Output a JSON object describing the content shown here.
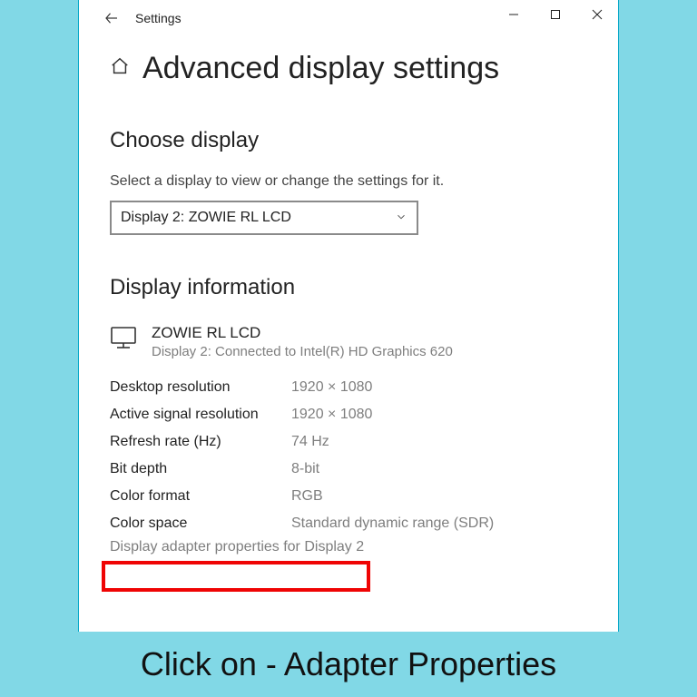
{
  "titlebar": {
    "title": "Settings"
  },
  "page": {
    "heading": "Advanced display settings"
  },
  "choose": {
    "title": "Choose display",
    "subtitle": "Select a display to view or change the settings for it.",
    "selected": "Display 2: ZOWIE RL LCD"
  },
  "info": {
    "title": "Display information",
    "display_name": "ZOWIE RL LCD",
    "display_conn": "Display 2: Connected to Intel(R) HD Graphics 620",
    "rows": [
      {
        "label": "Desktop resolution",
        "value": "1920 × 1080"
      },
      {
        "label": "Active signal resolution",
        "value": "1920 × 1080"
      },
      {
        "label": "Refresh rate (Hz)",
        "value": "74 Hz"
      },
      {
        "label": "Bit depth",
        "value": "8-bit"
      },
      {
        "label": "Color format",
        "value": "RGB"
      },
      {
        "label": "Color space",
        "value": "Standard dynamic range (SDR)"
      }
    ],
    "adapter_link": "Display adapter properties for Display 2"
  },
  "callout": {
    "text": "Click on - Adapter Properties"
  }
}
